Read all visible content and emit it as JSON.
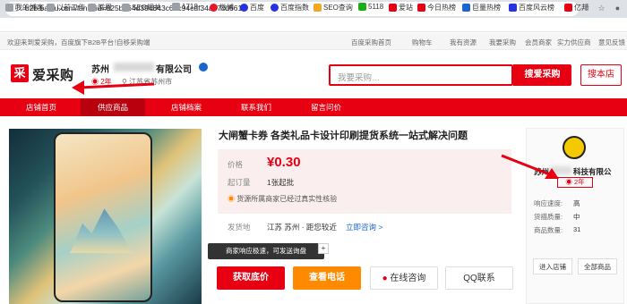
{
  "browser": {
    "url": "b2b.baidu.com/land?id=825b064d394843c61c94cdf34a37cd6610",
    "bookmarks": [
      "我的博客",
      "以前工作",
      "常用",
      "SEO相关",
      "1718",
      "微博",
      "百度",
      "百度指数",
      "SEO查询",
      "5118",
      "爱站",
      "今日热榜",
      "巨量热榜",
      "百度风云榜",
      "亿邦"
    ]
  },
  "site_bar": {
    "welcome": "欢迎来到爱采购，百度旗下B2B平台！",
    "nav_dropdown": "自移采购端",
    "right_links": [
      "百度采购首页",
      "购物车",
      "我有资源",
      "我要采购",
      "会员商家",
      "实力供应商",
      "意见反馈"
    ]
  },
  "header": {
    "logo_text": "爱采购",
    "shop_prefix": "苏州",
    "shop_suffix": "有限公司",
    "badge_year": "2年",
    "location": "江苏省苏州市",
    "search_placeholder": "我要采购…",
    "search_button": "搜爱采购",
    "shop_search_button": "搜本店"
  },
  "nav": {
    "items": [
      "店铺首页",
      "供应商品",
      "店铺档案",
      "联系我们",
      "留言问价"
    ]
  },
  "product": {
    "title": "大闸蟹卡券 各类礼品卡设计印刷提货系统一站式解决问题",
    "price_label": "价格",
    "price": "¥0.30",
    "moq_label": "起订量",
    "moq": "1张起批",
    "verify_text": "货源所属商家已经过真实性核验",
    "ship_label": "发货地",
    "ship_to": "江苏 苏州 · 距您较近",
    "ask_link": "立即咨询 >",
    "tooltip": "商家响应极速，可发送询盘"
  },
  "buttons": {
    "get_price": "获取底价",
    "view_phone": "查看电话",
    "online_chat": "在线咨询",
    "qq": "QQ联系"
  },
  "store_card": {
    "name_prefix": "苏州",
    "name_suffix": "科技有限公",
    "years": "2年",
    "stats": [
      {
        "label": "响应速度:",
        "value": "高"
      },
      {
        "label": "货描质量:",
        "value": "中"
      },
      {
        "label": "商品数量:",
        "value": "31"
      }
    ],
    "enter_store": "进入店铺",
    "all_products": "全部商品"
  },
  "colors": {
    "brand_red": "#e60012",
    "orange": "#ff8a00",
    "price_bg": "#fbeeee"
  }
}
